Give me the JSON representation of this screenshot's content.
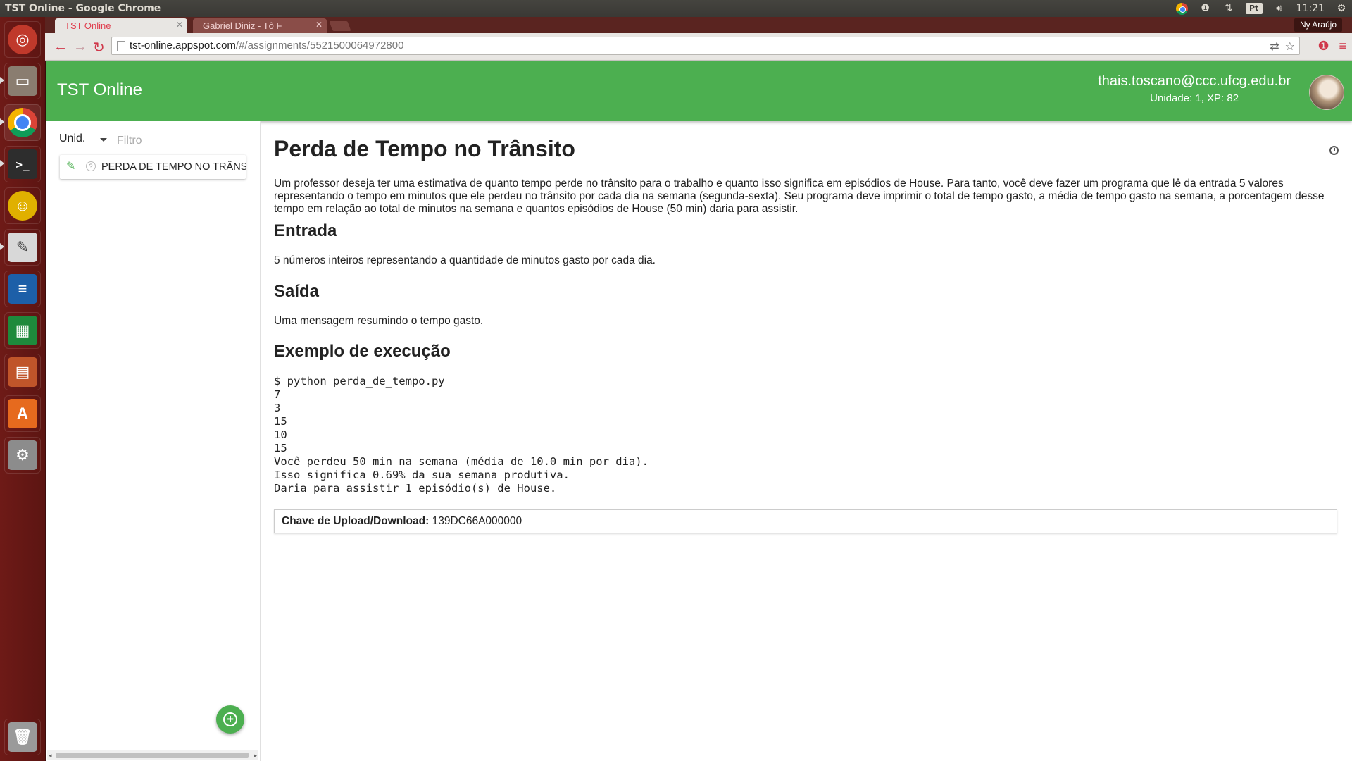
{
  "os": {
    "window_title": "TST Online - Google Chrome",
    "tray": {
      "keyboard_layout": "Pt",
      "time": "11:21"
    },
    "launcher": [
      {
        "name": "ubuntu-dash",
        "color": "#c0392b"
      },
      {
        "name": "files",
        "color": "#8a7d70"
      },
      {
        "name": "chrome",
        "color": "#e8e8e8"
      },
      {
        "name": "terminal",
        "color": "#2d2d2d"
      },
      {
        "name": "pidgin",
        "color": "#e0b000"
      },
      {
        "name": "text-editor",
        "color": "#d8d8d8"
      },
      {
        "name": "writer",
        "color": "#1d5fa8"
      },
      {
        "name": "calc",
        "color": "#1e8a3c"
      },
      {
        "name": "impress",
        "color": "#c0552a"
      },
      {
        "name": "software-center",
        "color": "#e66a1e"
      },
      {
        "name": "system-settings",
        "color": "#8c8c8c"
      },
      {
        "name": "trash",
        "color": "#9a9a9a"
      }
    ]
  },
  "browser": {
    "tabs": [
      {
        "label": "TST Online",
        "active": true
      },
      {
        "label": "Gabriel Diniz - Tô F",
        "active": false
      }
    ],
    "profile_name": "Ny Araújo",
    "url_host": "tst-online.appspot.com",
    "url_path": "/#/assignments/5521500064972800"
  },
  "app": {
    "title": "TST Online",
    "accent_color": "#4caf50",
    "user": {
      "email": "thais.toscano@ccc.ufcg.edu.br",
      "stats": "Unidade: 1, XP: 82"
    },
    "sidebar": {
      "unit_select": "Unid.",
      "filter_placeholder": "Filtro",
      "assignments": [
        {
          "label": "PERDA DE TEMPO NO TRÂNSITO"
        }
      ]
    },
    "assignment": {
      "title": "Perda de Tempo no Trânsito",
      "description": "Um professor deseja ter uma estimativa de quanto tempo perde no trânsito para o trabalho e quanto isso significa em episódios de House. Para tanto, você deve fazer um programa que lê da entrada 5 valores representando o tempo em minutos que ele perdeu no trânsito por cada dia na semana (segunda-sexta). Seu programa deve imprimir o total de tempo gasto, a média de tempo gasto na semana, a porcentagem desse tempo em relação ao total de minutos na semana e quantos episódios de House (50 min) daria para assistir.",
      "input_heading": "Entrada",
      "input_text": "5 números inteiros representando a quantidade de minutos gasto por cada dia.",
      "output_heading": "Saída",
      "output_text": "Uma mensagem resumindo o tempo gasto.",
      "example_heading": "Exemplo de execução",
      "example_code": "$ python perda_de_tempo.py\n7\n3\n15\n10\n15\nVocê perdeu 50 min na semana (média de 10.0 min por dia).\nIsso significa 0.69% da sua semana produtiva.\nDaria para assistir 1 episódio(s) de House.",
      "key_label": "Chave de Upload/Download:",
      "key_value": "139DC66A000000"
    }
  }
}
